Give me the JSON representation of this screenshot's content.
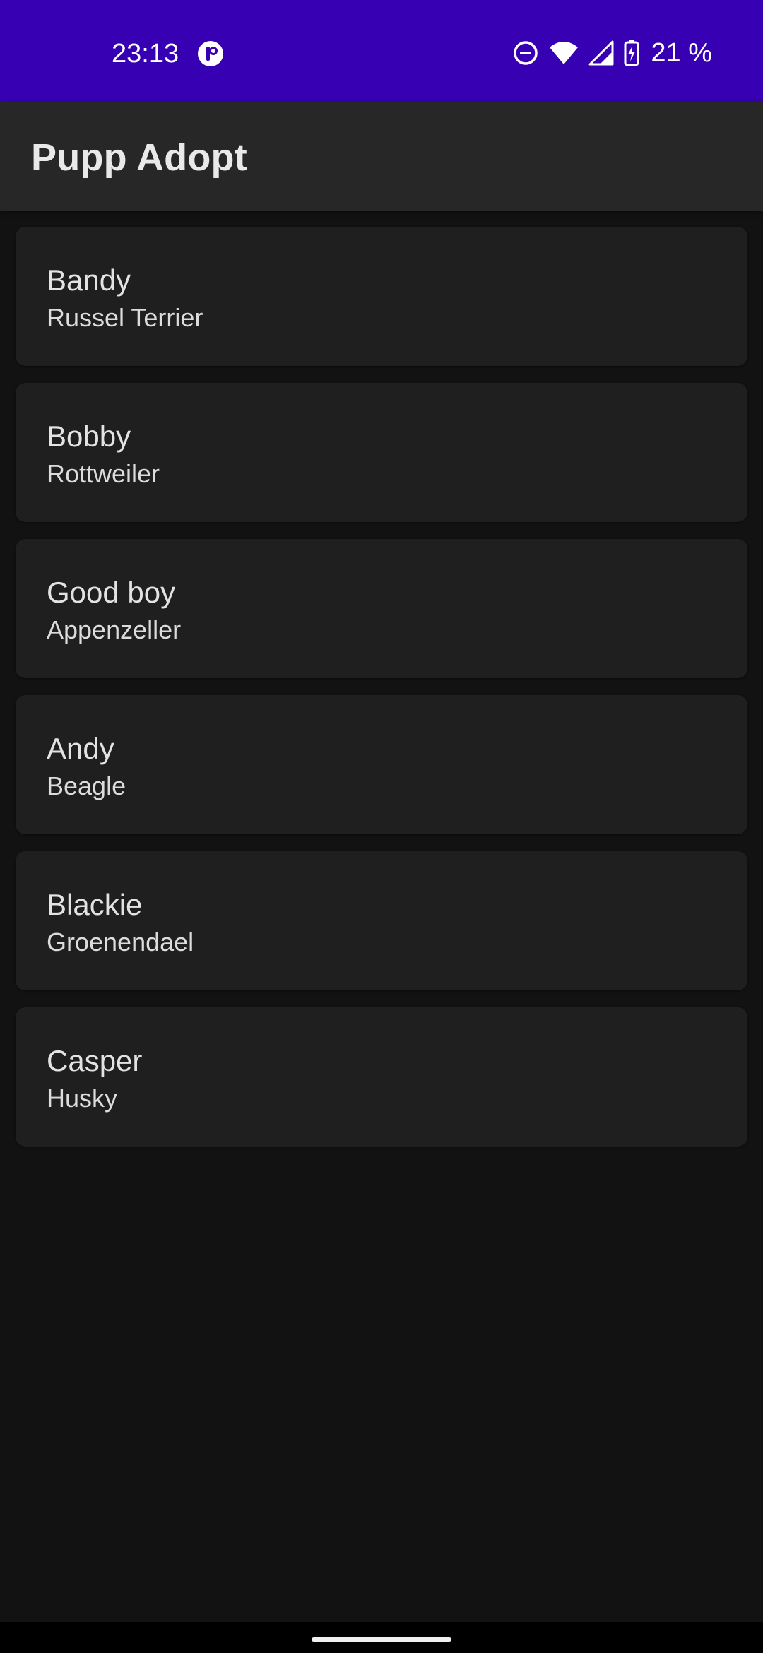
{
  "status_bar": {
    "time": "23:13",
    "battery": "21 %",
    "background_color": "#3700b3",
    "icons": [
      "app-notification-icon",
      "do-not-disturb-icon",
      "wifi-icon",
      "cell-signal-icon",
      "battery-charging-icon"
    ]
  },
  "app_bar": {
    "title": "Pupp Adopt",
    "background_color": "#272727"
  },
  "dogs": [
    {
      "name": "Bandy",
      "breed": "Russel Terrier"
    },
    {
      "name": "Bobby",
      "breed": "Rottweiler"
    },
    {
      "name": "Good boy",
      "breed": "Appenzeller"
    },
    {
      "name": "Andy",
      "breed": "Beagle"
    },
    {
      "name": "Blackie",
      "breed": "Groenendael"
    },
    {
      "name": "Casper",
      "breed": "Husky"
    }
  ],
  "theme": {
    "page_background": "#121212",
    "card_background": "#1f1f1f"
  }
}
